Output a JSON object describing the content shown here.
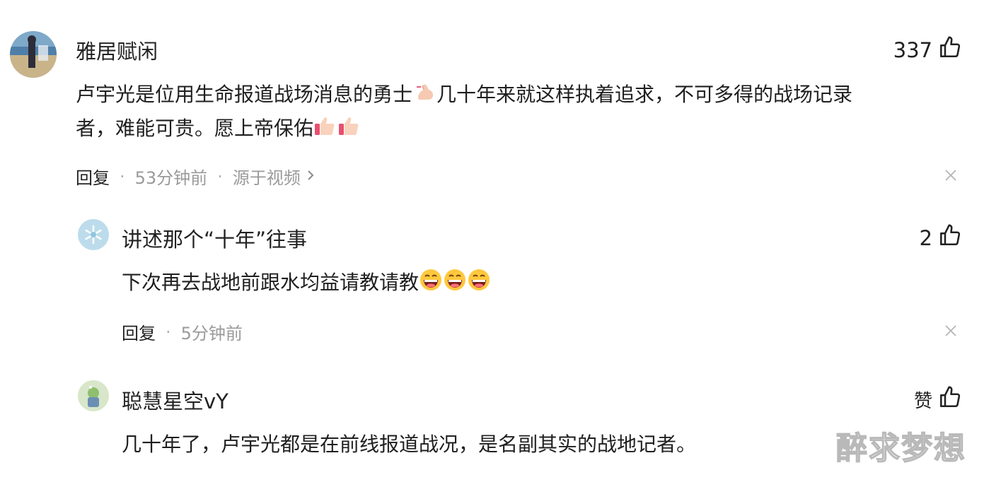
{
  "comments": [
    {
      "username": "雅居赋闲",
      "likes": "337",
      "text_line1": "卢宇光是位用生命报道战场消息的勇士",
      "text_line1b": "几十年来就这样执着追求，不可多得的战场记录",
      "text_line2": "者，难能可贵。愿上帝保佑",
      "reply_label": "回复",
      "time": "53分钟前",
      "source": "源于视频",
      "emoji": [
        "flexed-biceps-emoji",
        "thumbs-up-emoji",
        "thumbs-up-emoji"
      ]
    },
    {
      "username": "讲述那个“十年”往事",
      "likes": "2",
      "text": "下次再去战地前跟水均益请教请教",
      "reply_label": "回复",
      "time": "5分钟前",
      "emoji": [
        "grinning-face-emoji",
        "grinning-face-emoji",
        "grinning-face-emoji"
      ]
    },
    {
      "username": "聪慧星空vY",
      "likes": "赞",
      "text": "几十年了，卢宇光都是在前线报道战况，是名副其实的战地记者。"
    }
  ],
  "watermark": "醉求梦想",
  "colors": {
    "text": "#222222",
    "meta": "#9a9a9a",
    "background": "#ffffff"
  }
}
